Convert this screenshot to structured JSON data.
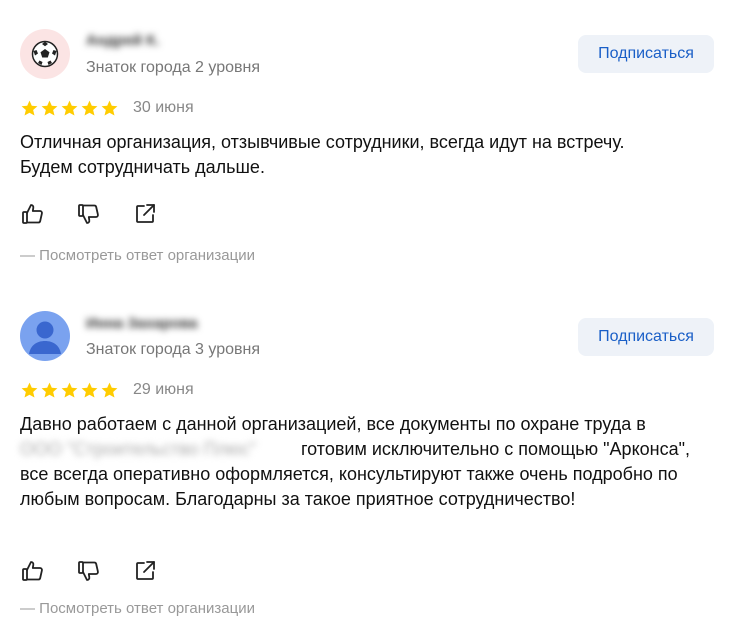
{
  "reviews": [
    {
      "author_name": "Андрей К.",
      "author_level": "Знаток города 2 уровня",
      "subscribe_label": "Подписаться",
      "rating": 5,
      "date": "30 июня",
      "text_line1": "Отличная организация, отзывчивые сотрудники, всегда идут на встречу.",
      "text_line2": "Будем сотрудничать дальше.",
      "org_reply_label": "— Посмотреть ответ организации",
      "avatar_icon": "soccer-ball-icon"
    },
    {
      "author_name": "Инна Захарова",
      "author_level": "Знаток города 3 уровня",
      "subscribe_label": "Подписаться",
      "rating": 5,
      "date": "29 июня",
      "text_before_org": "Давно работаем с данной организацией, все документы по охране труда в",
      "org_name": "ООО \"Строительство Плюс\"",
      "text_after_org": "готовим исключительно с помощью",
      "text_rest": "\"Арконса\", все всегда оперативно оформляется, консультируют также очень подробно по любым вопросам. Благодарны за такое приятное сотрудничество!",
      "org_reply_label": "— Посмотреть ответ организации",
      "avatar_icon": "user-avatar-icon"
    }
  ],
  "colors": {
    "star": "#ffcc00",
    "subscribe_text": "#1a5fc7",
    "subscribe_bg": "#eef2f8",
    "muted_text": "#777777"
  }
}
